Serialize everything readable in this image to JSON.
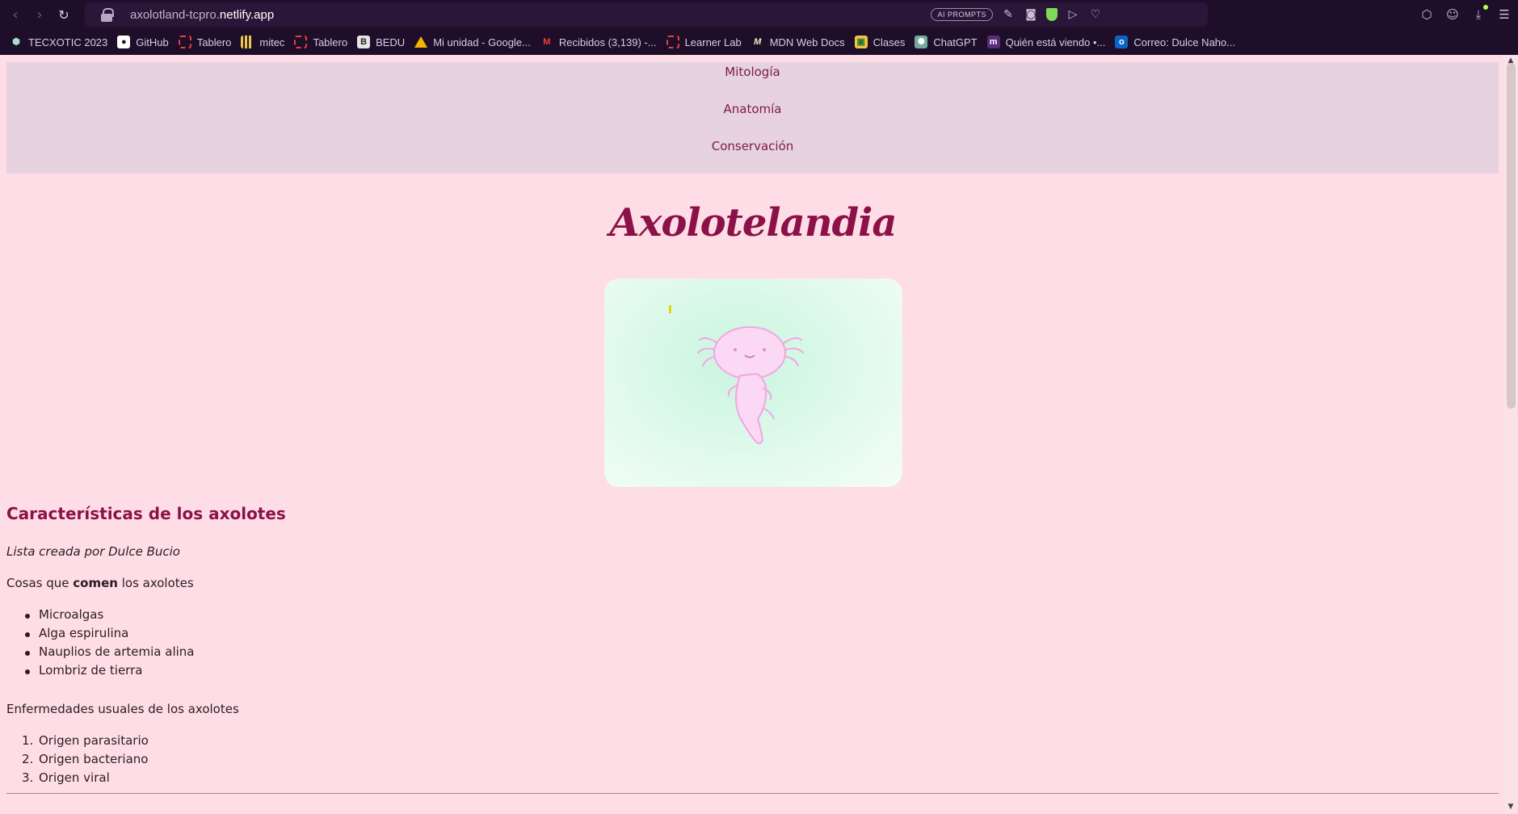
{
  "browser": {
    "url_host": "axolotland-tcpro.",
    "url_domain": "netlify.app",
    "ai_prompts_label": "AI PROMPTS"
  },
  "bookmarks": [
    {
      "label": "TECXOTIC 2023",
      "icon": "hexagon-icon"
    },
    {
      "label": "GitHub",
      "icon": "github-icon"
    },
    {
      "label": "Tablero",
      "icon": "canvas-ring-icon"
    },
    {
      "label": "mitec",
      "icon": "bars-icon"
    },
    {
      "label": "Tablero",
      "icon": "canvas-ring-icon"
    },
    {
      "label": "BEDU",
      "icon": "bedu-icon"
    },
    {
      "label": "Mi unidad - Google...",
      "icon": "google-drive-icon"
    },
    {
      "label": "Recibidos (3,139) -...",
      "icon": "gmail-icon"
    },
    {
      "label": "Learner Lab",
      "icon": "canvas-ring-icon"
    },
    {
      "label": "MDN Web Docs",
      "icon": "mdn-icon"
    },
    {
      "label": "Clases",
      "icon": "classroom-icon"
    },
    {
      "label": "ChatGPT",
      "icon": "chatgpt-icon"
    },
    {
      "label": "Quién está viendo •...",
      "icon": "m-icon"
    },
    {
      "label": "Correo: Dulce Naho...",
      "icon": "outlook-icon"
    }
  ],
  "nav": {
    "items": [
      "Mitología",
      "Anatomía",
      "Conservación"
    ]
  },
  "page": {
    "title": "Axolotelandia",
    "section_heading": "Características de los axolotes",
    "byline": "Lista creada por Dulce Bucio",
    "eat_prefix": "Cosas que ",
    "eat_bold": "comen",
    "eat_suffix": " los axolotes",
    "food_list": [
      "Microalgas",
      "Alga espirulina",
      "Nauplios de artemia alina",
      "Lombriz de tierra"
    ],
    "disease_intro": "Enfermedades usuales de los axolotes",
    "disease_list": [
      "Origen parasitario",
      "Origen bacteriano",
      "Origen viral"
    ]
  },
  "colors": {
    "page_bg": "#ffdde6",
    "nav_bg": "#e6d3df",
    "accent": "#8b1148",
    "chrome_bg": "#1f0e2a"
  }
}
